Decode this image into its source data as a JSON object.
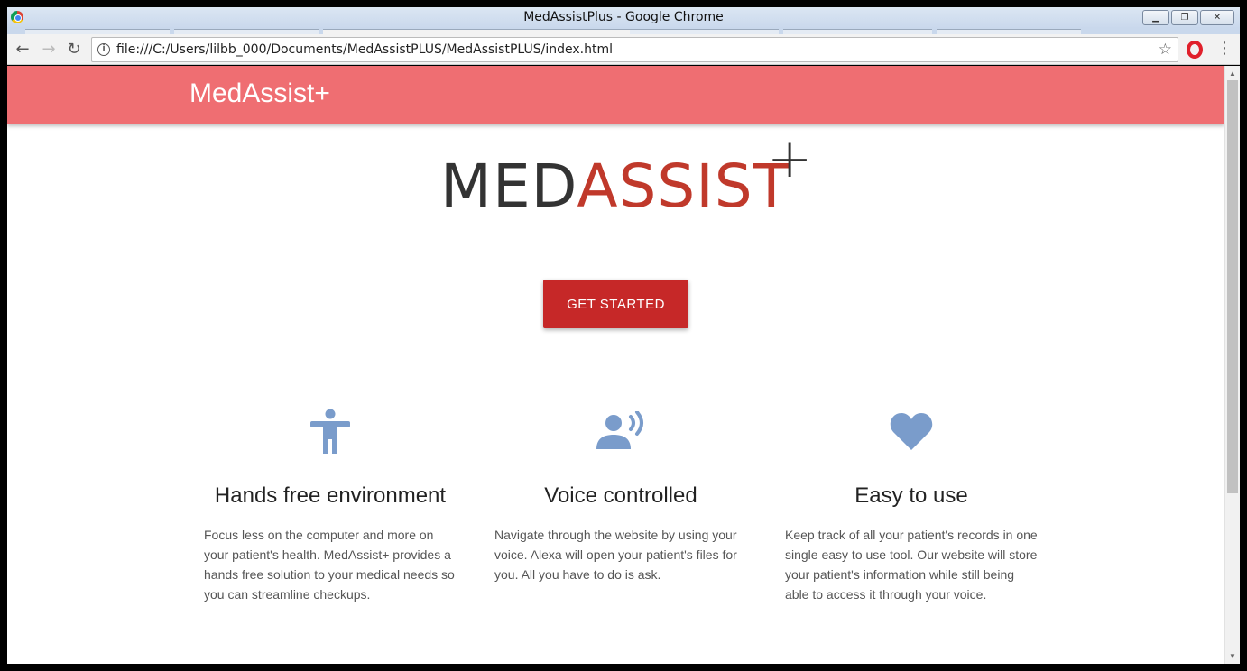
{
  "window": {
    "title": "MedAssistPlus - Google Chrome",
    "minimize": "▁",
    "restore": "❐",
    "close": "✕"
  },
  "toolbar": {
    "back": "←",
    "forward": "→",
    "reload": "↻",
    "url": "file:///C:/Users/lilbb_000/Documents/MedAssistPLUS/MedAssistPLUS/index.html",
    "info": "i",
    "star": "☆",
    "menu": "⋮"
  },
  "navbar": {
    "brand": "MedAssist+"
  },
  "hero": {
    "logo_med": "MED",
    "logo_assist": "ASSIST",
    "logo_plus": "+",
    "cta_label": "GET STARTED"
  },
  "features": [
    {
      "icon": "accessibility-icon",
      "title": "Hands free environment",
      "text": "Focus less on the computer and more on your patient's health. MedAssist+ provides a hands free solution to your medical needs so you can streamline checkups."
    },
    {
      "icon": "voice-icon",
      "title": "Voice controlled",
      "text": "Navigate through the website by using your voice. Alexa will open your patient's files for you. All you have to do is ask."
    },
    {
      "icon": "heart-icon",
      "title": "Easy to use",
      "text": "Keep track of all your patient's records in one single easy to use tool. Our website will store your patient's information while still being able to access it through your voice."
    }
  ],
  "colors": {
    "navbar": "#ef6e72",
    "accent": "#c0392b",
    "button": "#c62828",
    "icon": "#7a9ccb"
  }
}
